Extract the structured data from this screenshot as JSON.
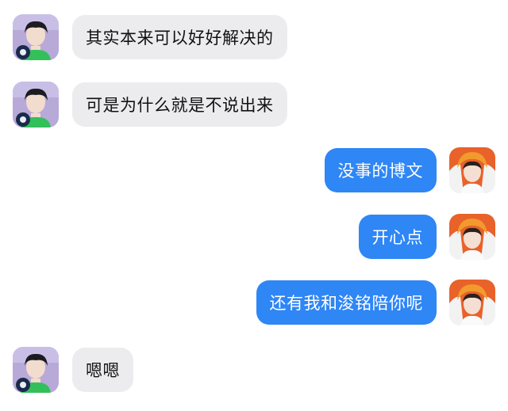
{
  "conversation": {
    "messages": [
      {
        "side": "left",
        "text": "其实本来可以好好解决的",
        "avatar": "boy-purple-bg-avatar"
      },
      {
        "side": "left",
        "text": "可是为什么就是不说出来",
        "avatar": "boy-purple-bg-avatar"
      },
      {
        "side": "right",
        "text": "没事的博文",
        "avatar": "boy-orange-hat-avatar"
      },
      {
        "side": "right",
        "text": "开心点",
        "avatar": "boy-orange-hat-avatar"
      },
      {
        "side": "right",
        "text": "还有我和浚铭陪你呢",
        "avatar": "boy-orange-hat-avatar"
      },
      {
        "side": "left",
        "text": "嗯嗯",
        "avatar": "boy-purple-bg-avatar"
      }
    ]
  },
  "colors": {
    "incoming_bubble": "#ececee",
    "outgoing_bubble": "#2f86f5",
    "background": "#ffffff"
  }
}
